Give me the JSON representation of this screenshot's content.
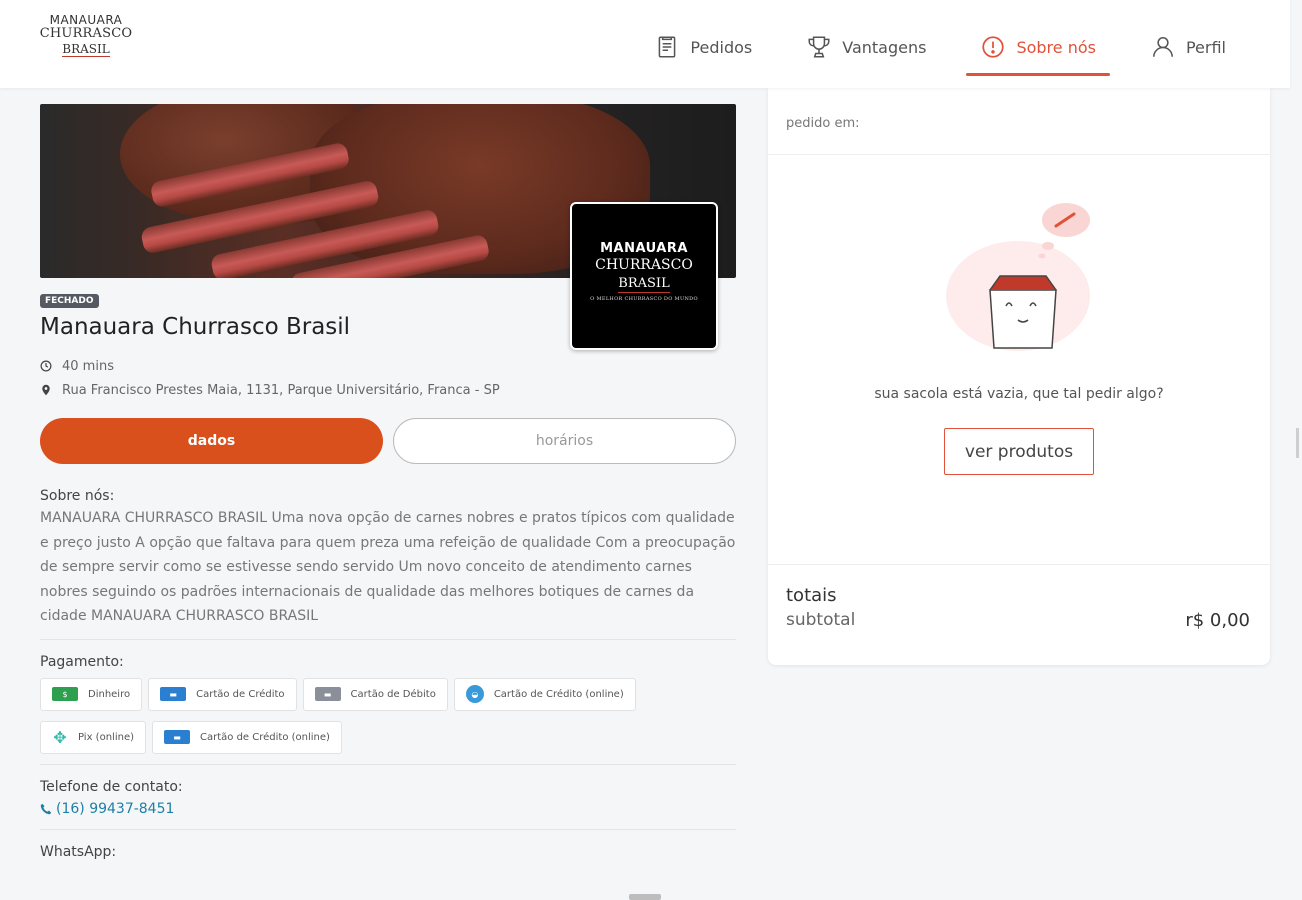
{
  "header": {
    "logo": {
      "line1": "MANAUARA",
      "line2": "CHURRASCO",
      "line3": "BRASIL"
    },
    "nav": [
      {
        "label": "Pedidos",
        "icon": "orders-icon"
      },
      {
        "label": "Vantagens",
        "icon": "trophy-icon"
      },
      {
        "label": "Sobre nós",
        "icon": "info-icon",
        "active": true
      },
      {
        "label": "Perfil",
        "icon": "user-icon"
      }
    ]
  },
  "store": {
    "logo": {
      "line1": "MANAUARA",
      "line2": "CHURRASCO",
      "line3": "BRASIL",
      "tagline": "O MELHOR CHURRASCO DO MUNDO"
    },
    "status": "FECHADO",
    "name": "Manauara Churrasco Brasil",
    "time": "40 mins",
    "address": "Rua Francisco Prestes Maia, 1131, Parque Universitário, Franca - SP"
  },
  "tabs": {
    "active": "dados",
    "inactive": "horários"
  },
  "about": {
    "title": "Sobre nós:",
    "text": "MANAUARA CHURRASCO BRASIL Uma nova opção de carnes nobres e pratos típicos com qualidade e preço justo A opção que faltava para quem preza uma refeição de qualidade Com a preocupação de sempre servir como se estivesse sendo servido Um novo conceito de atendimento carnes nobres seguindo os padrões internacionais de qualidade das melhores botiques de carnes da cidade MANAUARA CHURRASCO BRASIL"
  },
  "payment": {
    "title": "Pagamento:",
    "methods": [
      {
        "label": "Dinheiro",
        "icon": "cash-icon",
        "color": "#2e9e4f"
      },
      {
        "label": "Cartão de Crédito",
        "icon": "credit-card-icon",
        "color": "#2b7fd1"
      },
      {
        "label": "Cartão de Débito",
        "icon": "debit-card-icon",
        "color": "#8a8f99"
      },
      {
        "label": "Cartão de Crédito (online)",
        "icon": "online-card-icon",
        "color": "#3a9ad9"
      },
      {
        "label": "Pix (online)",
        "icon": "pix-icon",
        "color": "#32bcad"
      },
      {
        "label": "Cartão de Crédito (online)",
        "icon": "credit-card-icon",
        "color": "#2b7fd1"
      }
    ]
  },
  "contact": {
    "title": "Telefone de contato:",
    "phone": "(16) 99437-8451"
  },
  "whatsapp": {
    "title": "WhatsApp:"
  },
  "cart": {
    "head": "pedido em:",
    "empty": "sua sacola está vazia, que tal pedir algo?",
    "button": "ver produtos",
    "totals_title": "totais",
    "subtotal_label": "subtotal",
    "subtotal_value": "r$ 0,00"
  },
  "colors": {
    "accent": "#e0523a",
    "primary_button": "#d9501c",
    "link": "#1f7fa6"
  }
}
